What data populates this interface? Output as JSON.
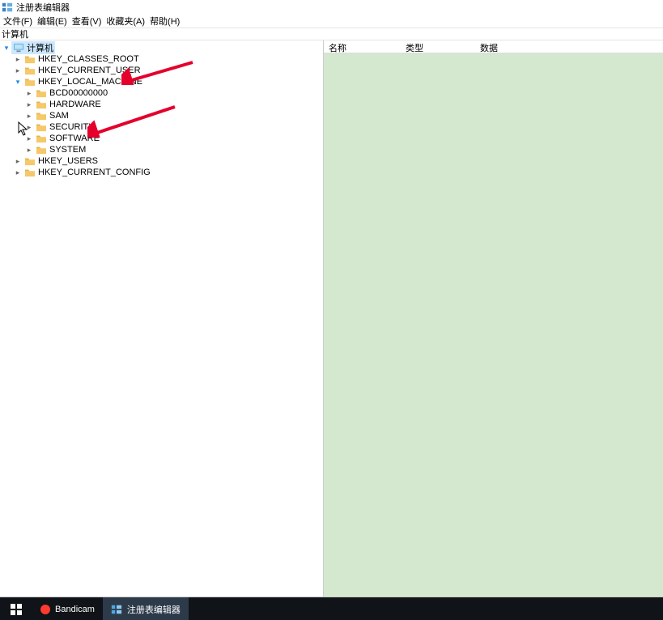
{
  "title": "注册表编辑器",
  "menu": {
    "file": "文件(F)",
    "edit": "编辑(E)",
    "view": "查看(V)",
    "favorites": "收藏夹(A)",
    "help": "帮助(H)"
  },
  "address": "计算机",
  "tree": {
    "root": "计算机",
    "hkcr": "HKEY_CLASSES_ROOT",
    "hkcu": "HKEY_CURRENT_USER",
    "hklm": "HKEY_LOCAL_MACHINE",
    "hklm_children": {
      "bcd": "BCD00000000",
      "hardware": "HARDWARE",
      "sam": "SAM",
      "security": "SECURITY",
      "software": "SOFTWARE",
      "system": "SYSTEM"
    },
    "hku": "HKEY_USERS",
    "hkcc": "HKEY_CURRENT_CONFIG"
  },
  "list_headers": {
    "name": "名称",
    "type": "类型",
    "data": "数据"
  },
  "taskbar": {
    "bandicam": "Bandicam",
    "regedit": "注册表编辑器"
  }
}
